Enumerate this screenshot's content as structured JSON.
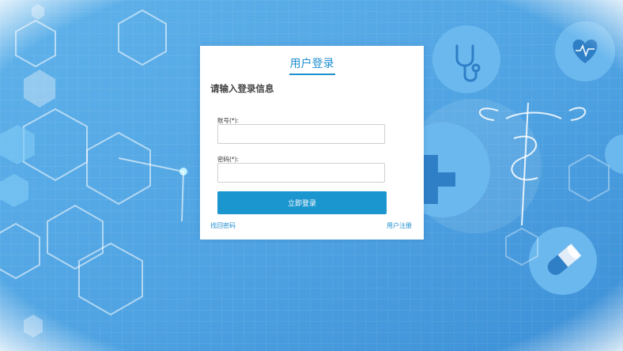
{
  "login": {
    "title": "用户登录",
    "subtitle": "请输入登录信息",
    "account_label": "账号(*):",
    "account_value": "",
    "password_label": "密码(*):",
    "password_value": "",
    "submit_label": "立即登录",
    "forgot_link": "找回密码",
    "register_link": "用户注册"
  },
  "colors": {
    "accent": "#1b96cf",
    "background": "#5aa9e6"
  },
  "icons": [
    "stethoscope-icon",
    "heart-icon",
    "medical-cross-icon",
    "caduceus-icon",
    "pill-icon"
  ]
}
